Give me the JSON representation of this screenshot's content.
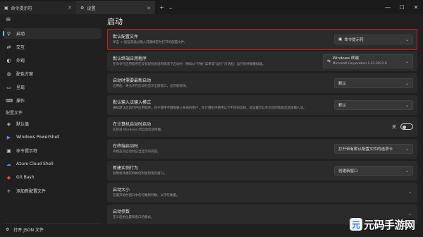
{
  "tabs": [
    {
      "label": "命令提示符",
      "icon": "terminal-icon"
    },
    {
      "label": "设置",
      "icon": "gear-icon"
    }
  ],
  "sidebar": {
    "items": [
      {
        "label": "启动",
        "icon": "rocket-icon"
      },
      {
        "label": "交互",
        "icon": "interaction-icon"
      },
      {
        "label": "外观",
        "icon": "palette-icon"
      },
      {
        "label": "配色方案",
        "icon": "color-scheme-icon"
      },
      {
        "label": "呈现",
        "icon": "monitor-icon"
      },
      {
        "label": "操作",
        "icon": "keyboard-icon"
      }
    ],
    "profiles_header": "配置文件",
    "profiles": [
      {
        "label": "默认值",
        "icon": "layers-icon"
      },
      {
        "label": "Windows PowerShell",
        "icon": "powershell-icon"
      },
      {
        "label": "命令提示符",
        "icon": "terminal-icon"
      },
      {
        "label": "Azure Cloud Shell",
        "icon": "cloud-icon"
      },
      {
        "label": "Git Bash",
        "icon": "git-icon"
      },
      {
        "label": "添加新配置文件",
        "icon": "plus-icon"
      }
    ],
    "open_json": "打开 JSON 文件"
  },
  "page": {
    "title": "启动",
    "cards": [
      {
        "title": "默认配置文件",
        "desc": "单击 + 按钮或通过输入其键绑定时打开的配置文件。",
        "value": "命令提示符"
      },
      {
        "title": "默认终端应用程序",
        "desc": "在命令行应用程序在没有现有会话的情况下启动时（例如从“开始”菜单或“运行”对话框）运行的终端模拟器。",
        "value": "Windows 终端",
        "value2": "Microsoft Corporation  1.21.2911.0"
      },
      {
        "title": "启动时需要最新启动",
        "desc": "启用后，将允许在启动时显示全部窗口，这可能很烦。",
        "value": "默认"
      },
      {
        "title": "默认输入法输入模式",
        "desc": "通知默认启动打开应用程序。对于使用不键盘输入布局的用户，在计算机中使用以下不同的选择，此设置可以在启动时帮助您选择输入法。",
        "value": "默认"
      },
      {
        "title": "在计算机启动时启动",
        "desc": "在登录 Windows 时自动启动终端。",
        "value": "关"
      },
      {
        "title": "在终端启动时",
        "desc": "终端首次启动时应当显示的内容。",
        "value": "打开带有默认配置文件的选项卡"
      },
      {
        "title": "新建实例行为",
        "desc": "控制新终端实例如何附加到现有窗口。",
        "value": "创建新窗口"
      },
      {
        "title": "启动大小",
        "desc": "在最开始时窗口中的行数和列数。以字符衡量。"
      },
      {
        "title": "启动参数",
        "desc": "定义起始位置和窗口的模式。"
      }
    ]
  },
  "watermark": {
    "mark": "元",
    "text": "元码手游网"
  },
  "colors": {
    "accent": "#60cdff",
    "highlight": "#d11f1f"
  }
}
